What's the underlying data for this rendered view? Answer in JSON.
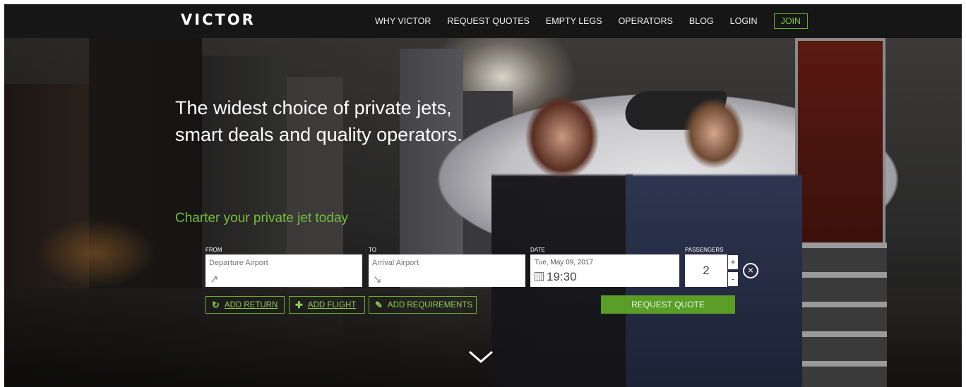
{
  "brand": {
    "logo_text": "VICTOR",
    "accent_color": "#6aae2e",
    "nav_bg": "#161616"
  },
  "nav": {
    "items": [
      {
        "label": "WHY VICTOR"
      },
      {
        "label": "REQUEST QUOTES"
      },
      {
        "label": "EMPTY LEGS"
      },
      {
        "label": "OPERATORS"
      },
      {
        "label": "BLOG"
      },
      {
        "label": "LOGIN"
      }
    ],
    "join_label": "JOIN"
  },
  "hero": {
    "headline": "The widest choice of private jets, smart deals and quality operators.",
    "subheadline": "Charter your private jet today"
  },
  "search": {
    "from_label": "FROM",
    "from_placeholder": "Departure Airport",
    "from_icon": "arrow-northeast-icon",
    "to_label": "TO",
    "to_placeholder": "Arrival Airport",
    "to_icon": "arrow-southeast-icon",
    "date_label": "DATE",
    "date_value": "Tue, May 09, 2017",
    "time_value": "19:30",
    "passengers_label": "PASSENGERS",
    "passengers_value": "2",
    "increment": "+",
    "decrement": "-"
  },
  "actions": {
    "add_return": "ADD RETURN",
    "add_flight": "ADD FLIGHT",
    "add_requirements": "ADD REQUIREMENTS",
    "request_quote": "REQUEST QUOTE"
  }
}
